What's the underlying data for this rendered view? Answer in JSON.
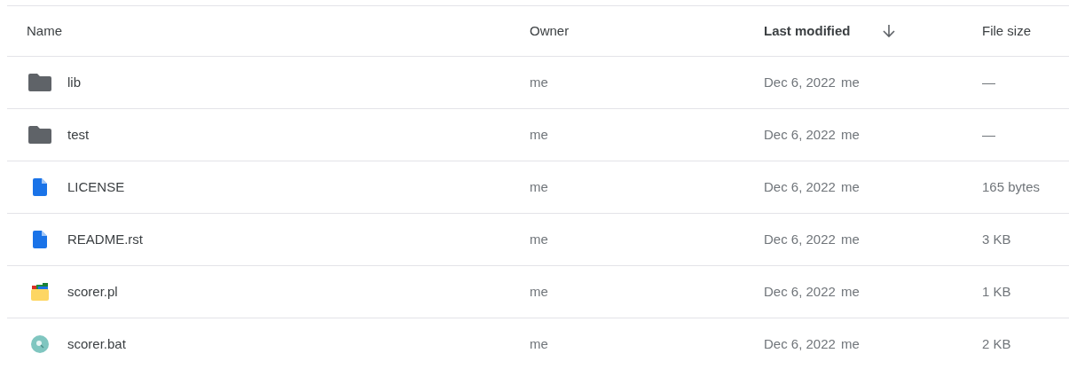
{
  "columns": [
    {
      "label": "Name",
      "sorted": false
    },
    {
      "label": "Owner",
      "sorted": false
    },
    {
      "label": "Last modified",
      "sorted": true
    },
    {
      "label": "File size",
      "sorted": false
    }
  ],
  "rows": [
    {
      "kind": "folder",
      "name": "lib",
      "owner": "me",
      "modified": "Dec 6, 2022",
      "modified_by": "me",
      "size": "—"
    },
    {
      "kind": "folder",
      "name": "test",
      "owner": "me",
      "modified": "Dec 6, 2022",
      "modified_by": "me",
      "size": "—"
    },
    {
      "kind": "document",
      "name": "LICENSE",
      "owner": "me",
      "modified": "Dec 6, 2022",
      "modified_by": "me",
      "size": "165 bytes"
    },
    {
      "kind": "document",
      "name": "README.rst",
      "owner": "me",
      "modified": "Dec 6, 2022",
      "modified_by": "me",
      "size": "3 KB"
    },
    {
      "kind": "archive",
      "name": "scorer.pl",
      "owner": "me",
      "modified": "Dec 6, 2022",
      "modified_by": "me",
      "size": "1 KB"
    },
    {
      "kind": "search",
      "name": "scorer.bat",
      "owner": "me",
      "modified": "Dec 6, 2022",
      "modified_by": "me",
      "size": "2 KB"
    }
  ]
}
